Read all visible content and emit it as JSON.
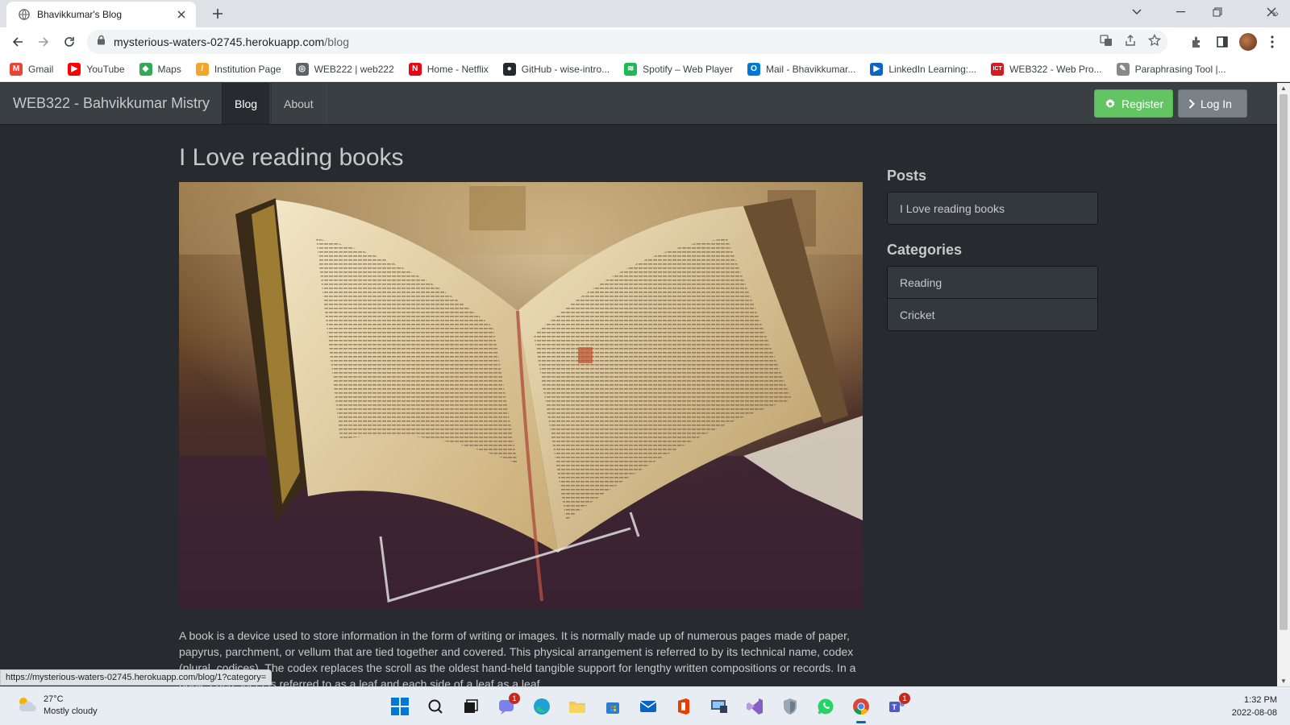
{
  "browser": {
    "tab_title": "Bhavikkumar's Blog",
    "url_host": "mysterious-waters-02745.herokuapp.com",
    "url_path": "/blog",
    "status_url": "https://mysterious-waters-02745.herokuapp.com/blog/1?category=",
    "bookmarks": [
      {
        "label": "Gmail",
        "icon": "gmail-icon",
        "color": "#ea4335",
        "glyph": "M"
      },
      {
        "label": "YouTube",
        "icon": "youtube-icon",
        "color": "#ff0000",
        "glyph": "▶"
      },
      {
        "label": "Maps",
        "icon": "maps-icon",
        "color": "#34a853",
        "glyph": "◆"
      },
      {
        "label": "Institution Page",
        "icon": "institution-icon",
        "color": "#f4a62a",
        "glyph": "/"
      },
      {
        "label": "WEB222 | web222",
        "icon": "globe-icon",
        "color": "#5f6368",
        "glyph": "◎"
      },
      {
        "label": "Home - Netflix",
        "icon": "netflix-icon",
        "color": "#e50914",
        "glyph": "N"
      },
      {
        "label": "GitHub - wise-intro...",
        "icon": "github-icon",
        "color": "#24292e",
        "glyph": "●"
      },
      {
        "label": "Spotify – Web Player",
        "icon": "spotify-icon",
        "color": "#1db954",
        "glyph": "≋"
      },
      {
        "label": "Mail - Bhavikkumar...",
        "icon": "outlook-icon",
        "color": "#0078d4",
        "glyph": "O"
      },
      {
        "label": "LinkedIn Learning:...",
        "icon": "linkedin-learning-icon",
        "color": "#0a66c2",
        "glyph": "▶"
      },
      {
        "label": "WEB322 - Web Pro...",
        "icon": "ict-icon",
        "color": "#d71920",
        "glyph": "ICT"
      },
      {
        "label": "Paraphrasing Tool |...",
        "icon": "pen-icon",
        "color": "#888888",
        "glyph": "✎"
      }
    ]
  },
  "site": {
    "brand": "WEB322 - Bahvikkumar Mistry",
    "nav": [
      {
        "label": "Blog",
        "active": true
      },
      {
        "label": "About",
        "active": false
      }
    ],
    "register_label": "Register",
    "login_label": "Log In"
  },
  "post": {
    "title": "I Love reading books",
    "image_alt": "Open antique book on a display stand",
    "body": "A book is a device used to store information in the form of writing or images. It is normally made up of numerous pages made of paper, papyrus, parchment, or vellum that are tied together and covered. This physical arrangement is referred to by its technical name, codex (plural, codices). The codex replaces the scroll as the oldest hand-held tangible support for lengthy written compositions or records. In a book, each sheet is referred to as a leaf and each side of a leaf as a leaf."
  },
  "sidebar": {
    "posts_heading": "Posts",
    "posts": [
      "I Love reading books"
    ],
    "categories_heading": "Categories",
    "categories": [
      "Reading",
      "Cricket"
    ]
  },
  "taskbar": {
    "temperature": "27°C",
    "weather": "Mostly cloudy",
    "time": "1:32 PM",
    "date": "2022-08-08",
    "badges": {
      "chat": "1",
      "teams": "1"
    }
  },
  "colors": {
    "page_bg": "#272b30",
    "navbar_bg": "#3a3f44",
    "success": "#62c462",
    "default_btn": "#7a8288"
  }
}
